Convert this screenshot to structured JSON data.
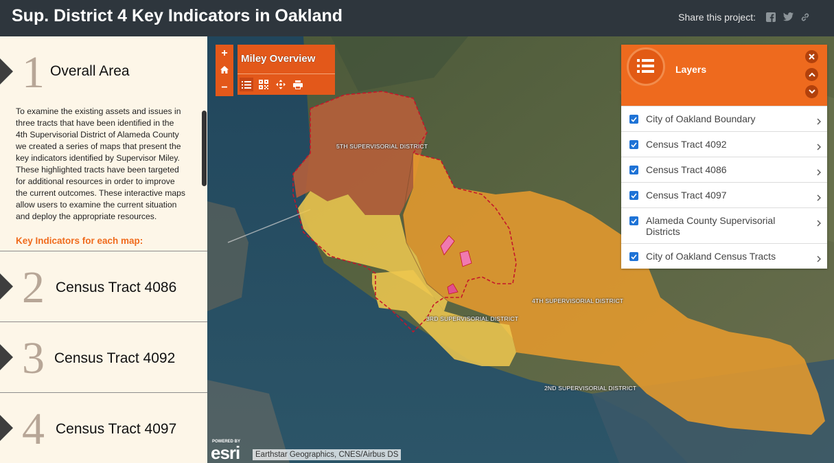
{
  "header": {
    "title": "Sup. District 4 Key Indicators in Oakland",
    "share_label": "Share this project:",
    "share_icons": [
      "facebook-icon",
      "twitter-icon",
      "link-icon"
    ]
  },
  "sidebar": {
    "sections": [
      {
        "number": "1",
        "title": "Overall Area",
        "description": "To examine the existing assets and issues in three tracts that have been identified in the 4th Supervisorial District of Alameda County we created a series of maps that present the key indicators identified by Supervisor Miley. These highlighted tracts have been targeted for additional resources in order to improve the current outcomes. These interactive maps allow users to examine the current situation and deploy the appropriate resources.",
        "subheading": "Key Indicators for each map:"
      },
      {
        "number": "2",
        "title": "Census Tract 4086"
      },
      {
        "number": "3",
        "title": "Census Tract 4092"
      },
      {
        "number": "4",
        "title": "Census Tract 4097"
      }
    ]
  },
  "map": {
    "zoom_in": "+",
    "zoom_out": "−",
    "home_icon": "home-icon",
    "overview": {
      "title": "Miley Overview",
      "tools": [
        "list-icon",
        "qr-icon",
        "move-icon",
        "print-icon"
      ]
    },
    "district_labels": {
      "d5": "5TH SUPERVISORIAL DISTRICT",
      "d4": "4TH SUPERVISORIAL DISTRICT",
      "d3": "3RD SUPERVISORIAL DISTRICT",
      "d2": "2ND SUPERVISORIAL DISTRICT"
    },
    "layers_panel": {
      "title": "Layers",
      "items": [
        {
          "label": "City of Oakland Boundary",
          "checked": true
        },
        {
          "label": "Census Tract 4092",
          "checked": true
        },
        {
          "label": "Census Tract 4086",
          "checked": true
        },
        {
          "label": "Census Tract 4097",
          "checked": true
        },
        {
          "label": "Alameda County Supervisorial Districts",
          "checked": true
        },
        {
          "label": "City of Oakland Census Tracts",
          "checked": true
        }
      ]
    },
    "powered_by": "POWERED BY",
    "esri_logo": "esri",
    "attribution": "Earthstar Geographics, CNES/Airbus DS",
    "colors": {
      "accent": "#ee6a1e",
      "district4": "#e59a2e",
      "district3": "#edc64e",
      "district5": "#b8603a",
      "tracts": "#f07ab0",
      "boundary": "#c4162a"
    }
  }
}
